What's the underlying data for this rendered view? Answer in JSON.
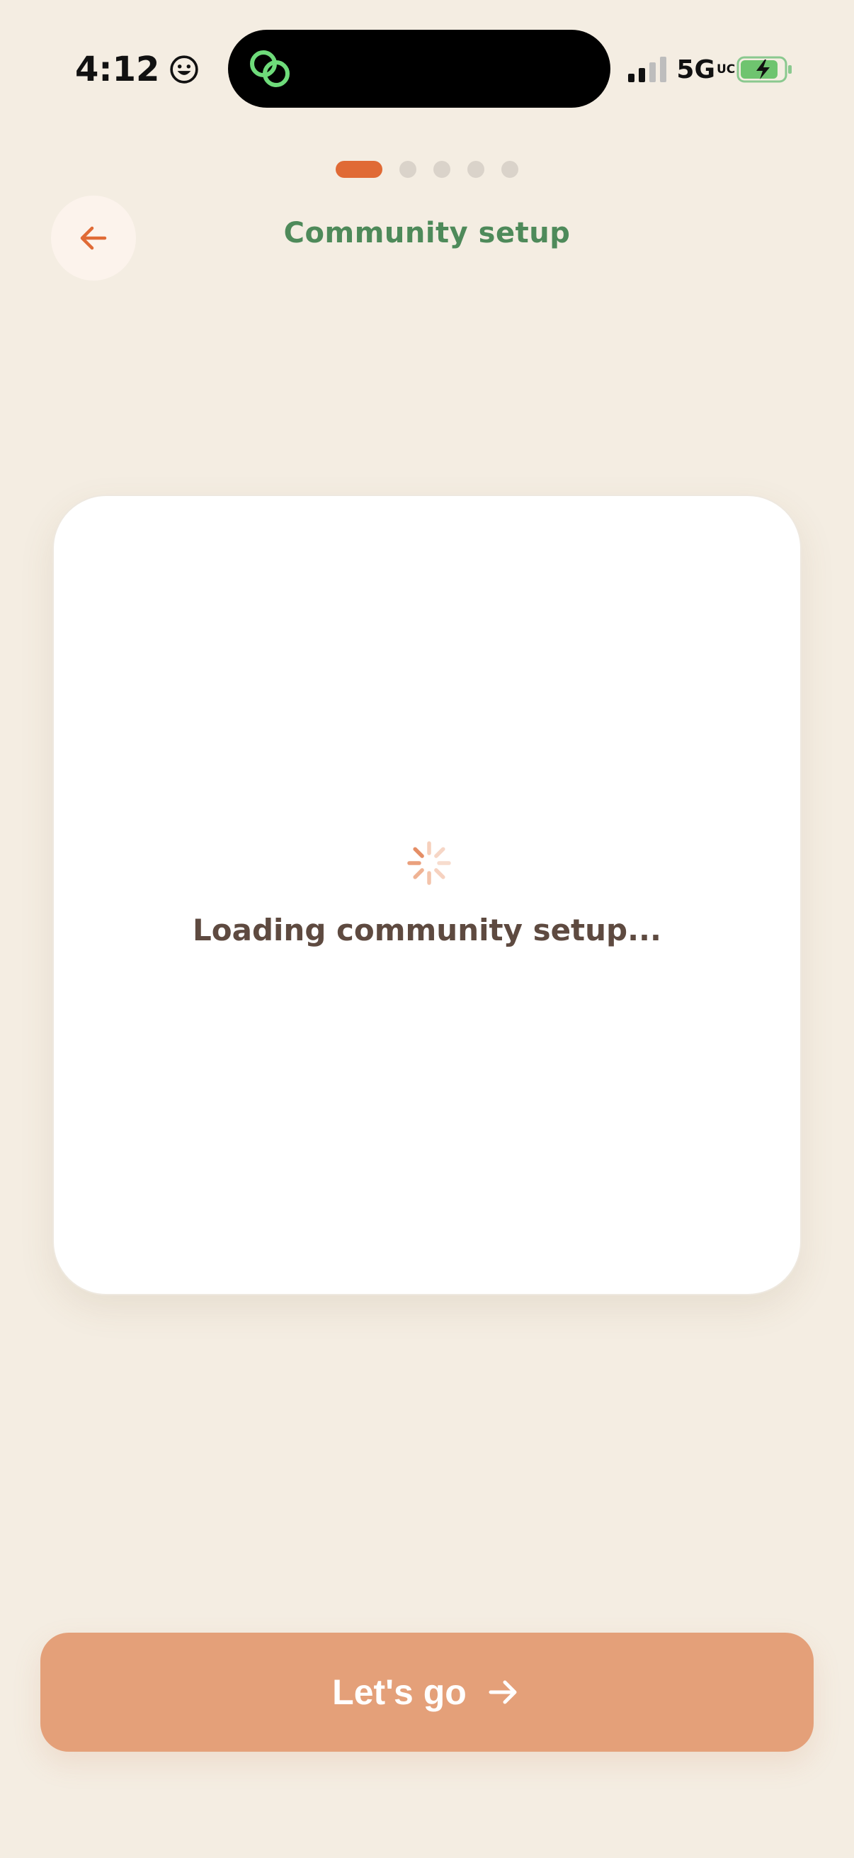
{
  "status_bar": {
    "time": "4:12",
    "network": "5G",
    "network_suffix": "UC"
  },
  "onboarding": {
    "steps_total": 5,
    "current_step": 1
  },
  "header": {
    "title": "Community setup",
    "back_icon": "arrow-left-icon"
  },
  "card": {
    "loading_text": "Loading community setup..."
  },
  "cta": {
    "label": "Let's go",
    "icon": "arrow-right-icon"
  },
  "colors": {
    "background": "#F4EDE2",
    "accent": "#E06A35",
    "title_green": "#4E8A5A",
    "cta_fill": "#E4A079",
    "text_brown": "#5E4A40"
  }
}
